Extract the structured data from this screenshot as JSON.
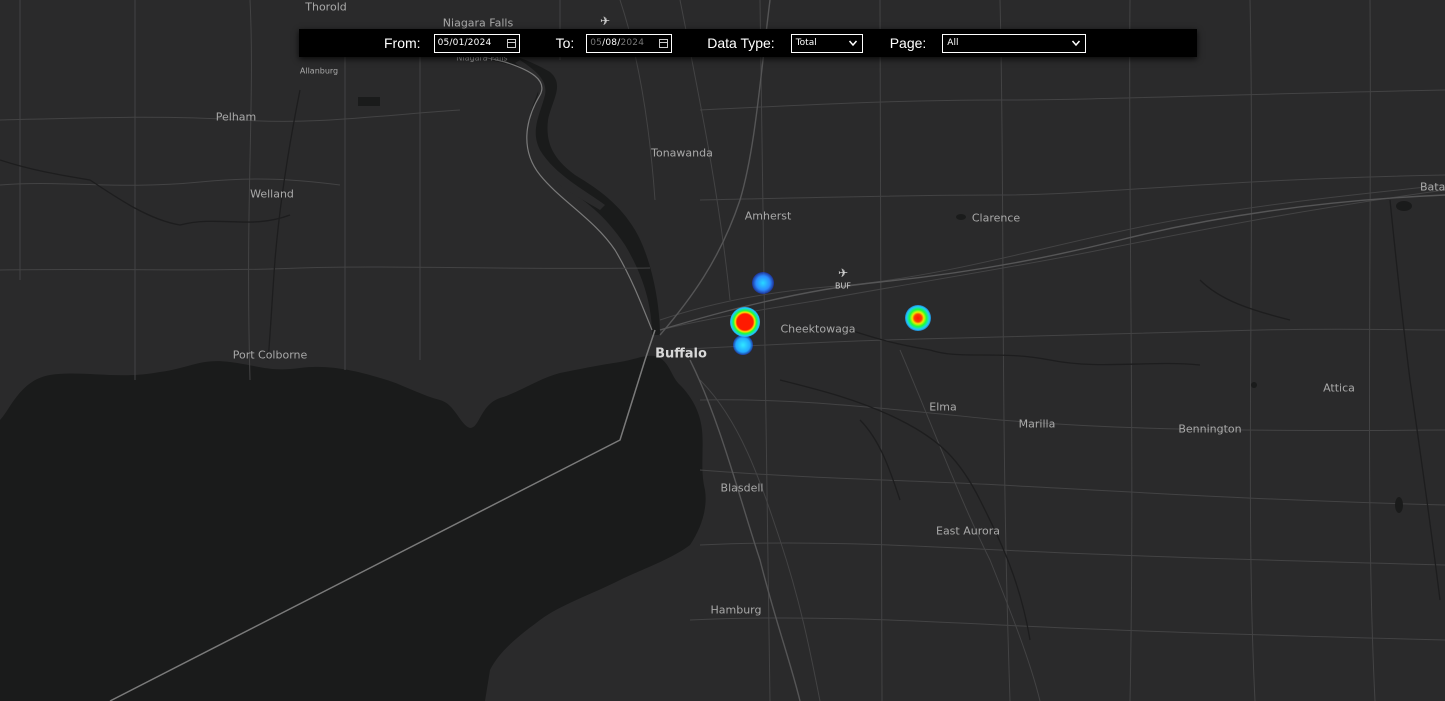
{
  "toolbar": {
    "from_label": "From:",
    "from_value": {
      "month": "05",
      "day": "01",
      "year": "2024"
    },
    "to_label": "To:",
    "to_value": {
      "month": "05",
      "day": "08",
      "year": "2024"
    },
    "data_type_label": "Data Type:",
    "data_type_value": "Total",
    "page_label": "Page:",
    "page_value": "All",
    "calendar_icon": "calendar-icon",
    "dropdown_icon": "chevron-down-icon"
  },
  "map": {
    "water_color": "#1a1b1b",
    "land_color": "#2a2a2b",
    "road_color": "#4a4a4b",
    "places": {
      "thorold": "Thorold",
      "niagara_falls_us": "Niagara Falls",
      "niagara_falls_ca": "Niagara Falls",
      "allanburg": "Allanburg",
      "pelham": "Pelham",
      "welland": "Welland",
      "port_colborne": "Port Colborne",
      "tonawanda": "Tonawanda",
      "amherst": "Amherst",
      "clarence": "Clarence",
      "batavia": "Bata",
      "buf": "BUF",
      "cheektowaga": "Cheektowaga",
      "buffalo": "Buffalo",
      "elma": "Elma",
      "marilla": "Marilla",
      "bennington": "Bennington",
      "attica": "Attica",
      "blasdell": "Blasdell",
      "east_aurora": "East Aurora",
      "hamburg": "Hamburg"
    },
    "airport_icon": "airplane-icon",
    "heat_colors": {
      "low": "#2a7bff",
      "mid": "#20e0ff",
      "high": "#ff1a00",
      "ring": "#1aff3a"
    }
  }
}
